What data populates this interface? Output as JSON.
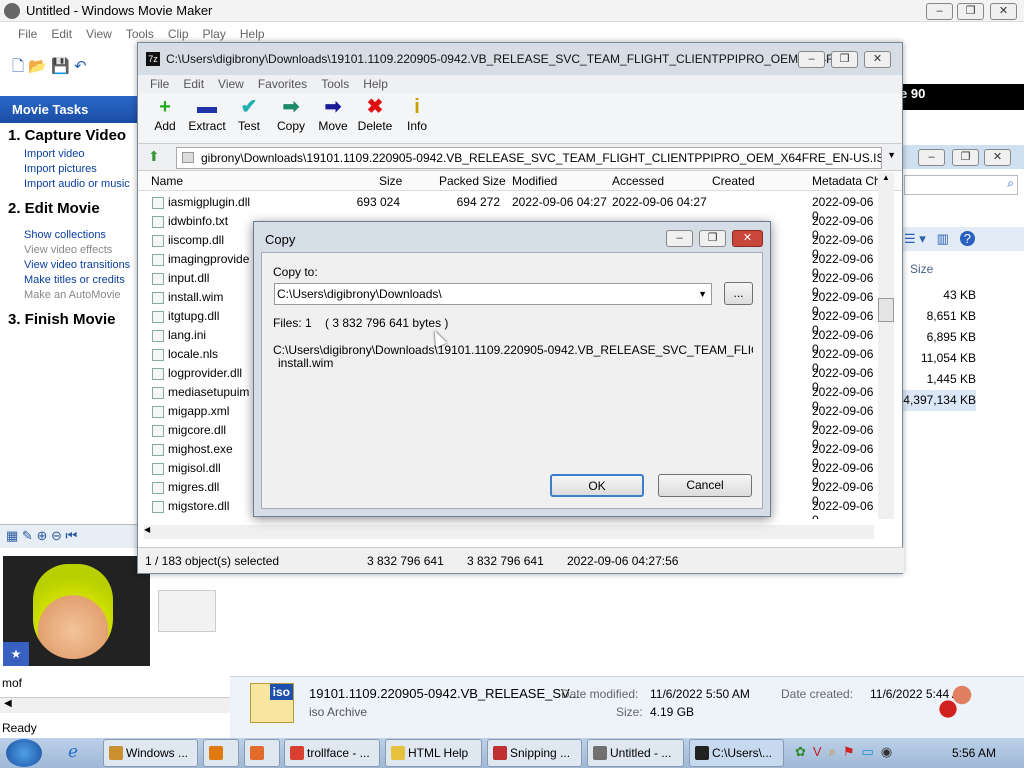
{
  "moviemaker": {
    "title": "Untitled - Windows Movie Maker",
    "menu": [
      "File",
      "Edit",
      "View",
      "Tools",
      "Clip",
      "Play",
      "Help"
    ],
    "tasks_header": "Movie Tasks",
    "sections": [
      {
        "title": "1. Capture Video",
        "links": [
          "Import video",
          "Import pictures",
          "Import audio or music"
        ]
      },
      {
        "title": "2. Edit Movie",
        "links": [
          "Show collections",
          "View video effects",
          "View video transitions",
          "Make titles or credits",
          "Make an AutoMovie"
        ]
      },
      {
        "title": "3. Finish Movie",
        "links": []
      }
    ],
    "clip_label": "mof",
    "status": "Ready",
    "collection_text": "e 90"
  },
  "sevenzip": {
    "title": "C:\\Users\\digibrony\\Downloads\\19101.1109.220905-0942.VB_RELEASE_SVC_TEAM_FLIGHT_CLIENTPPIPRO_OEM_X64F...",
    "menu": [
      "File",
      "Edit",
      "View",
      "Favorites",
      "Tools",
      "Help"
    ],
    "toolbar": [
      {
        "label": "Add",
        "icon": "+",
        "color": "#22aa22"
      },
      {
        "label": "Extract",
        "icon": "▬",
        "color": "#2233aa"
      },
      {
        "label": "Test",
        "icon": "✔",
        "color": "#20b0b0"
      },
      {
        "label": "Copy",
        "icon": "➡",
        "color": "#1c8a6a"
      },
      {
        "label": "Move",
        "icon": "➡",
        "color": "#1a1a99"
      },
      {
        "label": "Delete",
        "icon": "✖",
        "color": "#dd1111"
      },
      {
        "label": "Info",
        "icon": "i",
        "color": "#c8a000"
      }
    ],
    "address": "gibrony\\Downloads\\19101.1109.220905-0942.VB_RELEASE_SVC_TEAM_FLIGHT_CLIENTPPIPRO_OEM_X64FRE_EN-US.ISO\\sources\\",
    "columns": [
      "Name",
      "Size",
      "Packed Size",
      "Modified",
      "Accessed",
      "Created",
      "Metadata Ch"
    ],
    "rows": [
      [
        "iasmigplugin.dll",
        "693 024",
        "694 272",
        "2022-09-06 04:27",
        "2022-09-06 04:27",
        "2022-09-06 0"
      ],
      [
        "idwbinfo.txt",
        "",
        "",
        "",
        "",
        "2022-09-06 0"
      ],
      [
        "iiscomp.dll",
        "",
        "",
        "",
        "",
        "2022-09-06 0"
      ],
      [
        "imagingprovide",
        "",
        "",
        "",
        "",
        "2022-09-06 0"
      ],
      [
        "input.dll",
        "",
        "",
        "",
        "",
        "2022-09-06 0"
      ],
      [
        "install.wim",
        "",
        "",
        "",
        "",
        "2022-09-06 0"
      ],
      [
        "itgtupg.dll",
        "",
        "",
        "",
        "",
        "2022-09-06 0"
      ],
      [
        "lang.ini",
        "",
        "",
        "",
        "",
        "2022-09-06 0"
      ],
      [
        "locale.nls",
        "",
        "",
        "",
        "",
        "2022-09-06 0"
      ],
      [
        "logprovider.dll",
        "",
        "",
        "",
        "",
        "2022-09-06 0"
      ],
      [
        "mediasetupuim",
        "",
        "",
        "",
        "",
        "2022-09-06 0"
      ],
      [
        "migapp.xml",
        "",
        "",
        "",
        "",
        "2022-09-06 0"
      ],
      [
        "migcore.dll",
        "",
        "",
        "",
        "",
        "2022-09-06 0"
      ],
      [
        "mighost.exe",
        "",
        "",
        "",
        "",
        "2022-09-06 0"
      ],
      [
        "migisol.dll",
        "",
        "",
        "",
        "",
        "2022-09-06 0"
      ],
      [
        "migres.dll",
        "",
        "",
        "",
        "",
        "2022-09-06 0"
      ],
      [
        "migstore.dll",
        "",
        "",
        "",
        "",
        "2022-09-06 0"
      ]
    ],
    "status": [
      "1 / 183 object(s) selected",
      "3 832 796 641",
      "3 832 796 641",
      "2022-09-06 04:27:56"
    ]
  },
  "copy_dialog": {
    "title": "Copy",
    "copy_to_label": "Copy to:",
    "copy_to_value": "C:\\Users\\digibrony\\Downloads\\",
    "browse_label": "...",
    "files_info": "Files: 1    ( 3 832 796 641 bytes )",
    "path": "C:\\Users\\digibrony\\Downloads\\19101.1109.220905-0942.VB_RELEASE_SVC_TEAM_FLIGHT_CLIENTPPIPRO_OEM_X64FRE_EN-US.ISO\\sources\\",
    "file": "install.wim",
    "ok": "OK",
    "cancel": "Cancel"
  },
  "explorer": {
    "size_header": "Size",
    "sizes": [
      "43 KB",
      "8,651 KB",
      "6,895 KB",
      "11,054 KB",
      "1,445 KB",
      "4,397,134 KB"
    ],
    "details": {
      "name": "19101.1109.220905-0942.VB_RELEASE_SV...",
      "type": "iso Archive",
      "modified_label": "Date modified:",
      "modified": "11/6/2022 5:50 AM",
      "created_label": "Date created:",
      "created": "11/6/2022 5:44 AM",
      "size_label": "Size:",
      "size": "4.19 GB",
      "icon_text": "iso"
    }
  },
  "taskbar": {
    "items": [
      {
        "label": "Windows ...",
        "color": "#c89030"
      },
      {
        "label": "",
        "color": "#e07a10"
      },
      {
        "label": "",
        "color": "#e26a2c"
      },
      {
        "label": "trollface - ...",
        "color": "#d94030"
      },
      {
        "label": "HTML Help",
        "color": "#e8c040"
      },
      {
        "label": "Snipping ...",
        "color": "#c03030"
      },
      {
        "label": "Untitled - ...",
        "color": "#707070"
      },
      {
        "label": "C:\\Users\\...",
        "color": "#222222"
      }
    ],
    "clock": "5:56 AM"
  }
}
